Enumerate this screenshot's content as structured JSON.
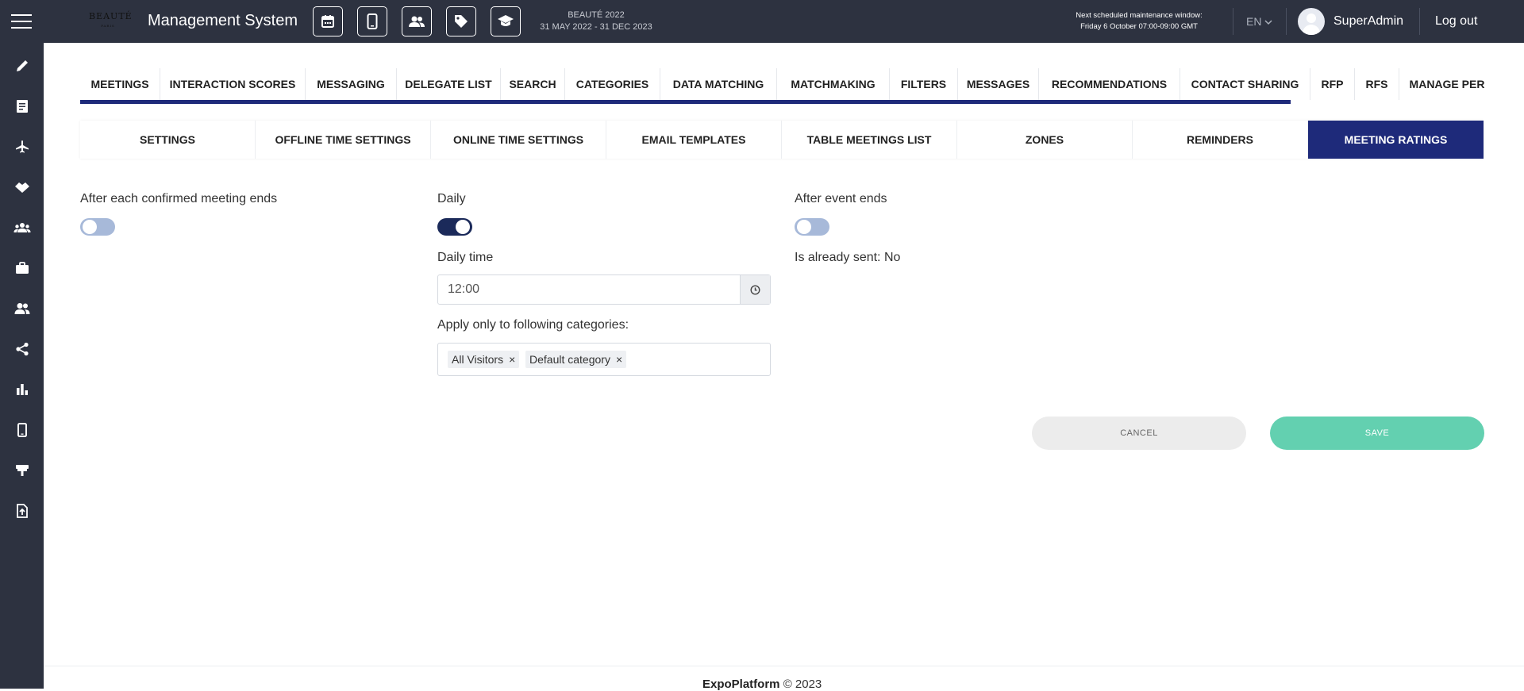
{
  "header": {
    "app_title": "Management System",
    "logo_text": "BEAUTÉ",
    "event_name": "BEAUTÉ 2022",
    "event_dates": "31 MAY 2022 - 31 DEC 2023",
    "maintenance_line1": "Next scheduled maintenance window:",
    "maintenance_line2": "Friday 6 October 07:00-09:00 GMT",
    "language": "EN",
    "username": "SuperAdmin",
    "logout_label": "Log out",
    "quick_actions": [
      "calendar-icon",
      "mobile-icon",
      "people-icon",
      "tag-icon",
      "graduation-cap-icon"
    ]
  },
  "sidebar": {
    "items": [
      "pencil-icon",
      "document-icon",
      "airplane-icon",
      "handshake-icon",
      "group-icon",
      "briefcase-icon",
      "users-icon",
      "share-icon",
      "bar-chart-icon",
      "mobile-icon",
      "booth-icon",
      "file-upload-icon"
    ]
  },
  "tabs": {
    "items": [
      "MEETINGS",
      "INTERACTION SCORES",
      "MESSAGING",
      "DELEGATE LIST",
      "SEARCH",
      "CATEGORIES",
      "DATA MATCHING",
      "MATCHMAKING",
      "FILTERS",
      "MESSAGES",
      "RECOMMENDATIONS",
      "CONTACT SHARING",
      "RFP",
      "RFS",
      "MANAGE PER"
    ]
  },
  "subtabs": {
    "items": [
      "SETTINGS",
      "OFFLINE TIME SETTINGS",
      "ONLINE TIME SETTINGS",
      "EMAIL TEMPLATES",
      "TABLE MEETINGS LIST",
      "ZONES",
      "REMINDERS",
      "MEETING RATINGS"
    ],
    "active": "MEETING RATINGS"
  },
  "form": {
    "after_meeting_label": "After each confirmed meeting ends",
    "after_meeting_enabled": false,
    "daily_label": "Daily",
    "daily_enabled": true,
    "daily_time_label": "Daily time",
    "daily_time_value": "12:00",
    "categories_label": "Apply only to following categories:",
    "categories": [
      "All Visitors",
      "Default category"
    ],
    "after_event_label": "After event ends",
    "after_event_enabled": false,
    "already_sent": "Is already sent: No"
  },
  "actions": {
    "cancel_label": "CANCEL",
    "save_label": "SAVE"
  },
  "footer": {
    "brand": "ExpoPlatform",
    "copyright": "© 2023"
  },
  "colors": {
    "topbar": "#2d3240",
    "accent": "#1e2a7a",
    "save": "#63d0b0",
    "toggle_on": "#1b2a5a",
    "toggle_off": "#a7b9d9"
  }
}
